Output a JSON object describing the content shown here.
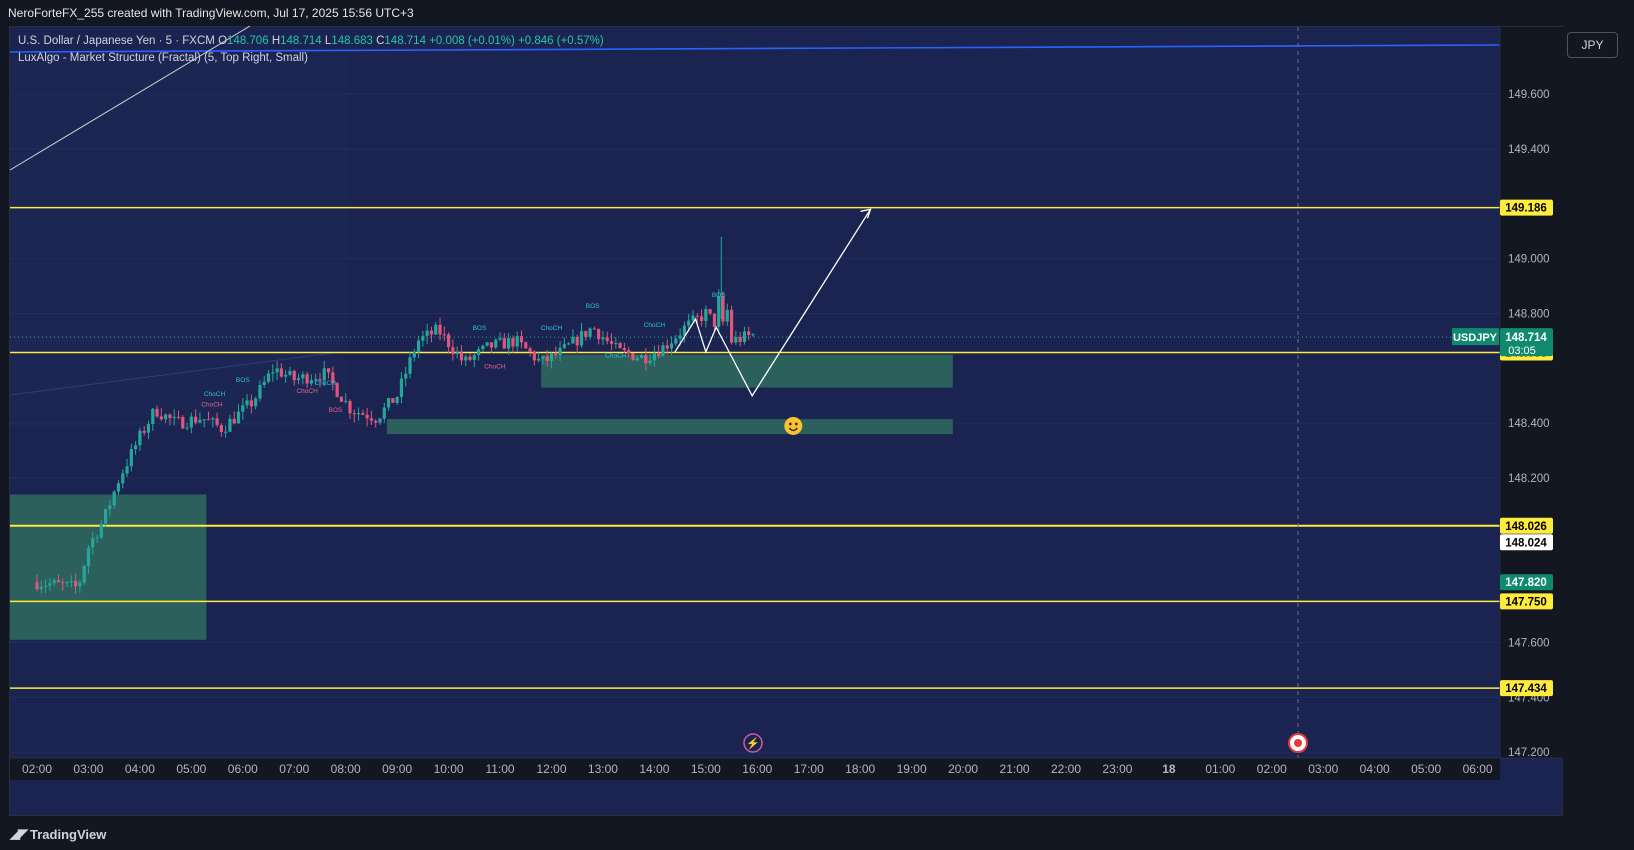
{
  "header": {
    "caption": "NeroForteFX_255 created with TradingView.com, Jul 17, 2025 15:56 UTC+3"
  },
  "legend": {
    "symbol": "U.S. Dollar / Japanese Yen · 5 · FXCM",
    "o_label": "O",
    "o": "148.706",
    "h_label": "H",
    "h": "148.714",
    "l_label": "L",
    "l": "148.683",
    "c_label": "C",
    "c": "148.714",
    "change": "+0.008 (+0.01%)",
    "change2": "+0.846 (+0.57%)",
    "indicator": "LuxAlgo - Market Structure (Fractal) (5, Top Right, Small)"
  },
  "currency_button": "JPY",
  "footer": {
    "brand": "TradingView"
  },
  "colors": {
    "pane_bg": "#1b2450",
    "up": "#26a69a",
    "down": "#ef5350",
    "level": "#ffeb3b",
    "trend": "#2962ff",
    "zone": "#2e6b5e"
  },
  "chart_data": {
    "type": "candlestick",
    "symbol_tag": "USDJPY",
    "last_price": "148.714",
    "countdown": "03:05",
    "y_ticks": [
      "149.600",
      "149.400",
      "149.000",
      "148.800",
      "148.400",
      "148.200",
      "147.600",
      "147.400",
      "147.200"
    ],
    "ylim": [
      147.2,
      149.75
    ],
    "x_ticks": [
      "02:00",
      "03:00",
      "04:00",
      "05:00",
      "06:00",
      "07:00",
      "08:00",
      "09:00",
      "10:00",
      "11:00",
      "12:00",
      "13:00",
      "14:00",
      "15:00",
      "16:00",
      "17:00",
      "18:00",
      "19:00",
      "20:00",
      "21:00",
      "22:00",
      "23:00",
      "18",
      "01:00",
      "02:00",
      "03:00",
      "04:00",
      "05:00",
      "06:00"
    ],
    "levels": [
      {
        "price": 149.186,
        "label": "149.186",
        "style": "yellow"
      },
      {
        "price": 148.658,
        "label": "148.658",
        "style": "yellow"
      },
      {
        "price": 148.026,
        "label": "148.026",
        "style": "yellow"
      },
      {
        "price": 148.024,
        "label": "148.024",
        "style": "white"
      },
      {
        "price": 147.82,
        "label": "147.820",
        "style": "green"
      },
      {
        "price": 147.75,
        "label": "147.750",
        "style": "yellow"
      },
      {
        "price": 147.434,
        "label": "147.434",
        "style": "yellow"
      }
    ],
    "structure_labels": [
      {
        "text": "ChoCH",
        "x": 3.4,
        "y": 148.46,
        "color": "down"
      },
      {
        "text": "ChoCH",
        "x": 3.45,
        "y": 148.5,
        "color": "up"
      },
      {
        "text": "BOS",
        "x": 4.0,
        "y": 148.55,
        "color": "up"
      },
      {
        "text": "ChoCH",
        "x": 5.25,
        "y": 148.51,
        "color": "down"
      },
      {
        "text": "ChoCH",
        "x": 5.6,
        "y": 148.54,
        "color": "up"
      },
      {
        "text": "BOS",
        "x": 5.8,
        "y": 148.44,
        "color": "down"
      },
      {
        "text": "BOS",
        "x": 8.6,
        "y": 148.74,
        "color": "up"
      },
      {
        "text": "ChoCH",
        "x": 8.9,
        "y": 148.6,
        "color": "down"
      },
      {
        "text": "ChoCH",
        "x": 10.0,
        "y": 148.74,
        "color": "up"
      },
      {
        "text": "BOS",
        "x": 10.8,
        "y": 148.82,
        "color": "up"
      },
      {
        "text": "ChoCH",
        "x": 11.25,
        "y": 148.64,
        "color": "up"
      },
      {
        "text": "ChoCH",
        "x": 12.0,
        "y": 148.75,
        "color": "up"
      },
      {
        "text": "BOS",
        "x": 13.25,
        "y": 148.86,
        "color": "up"
      }
    ]
  }
}
